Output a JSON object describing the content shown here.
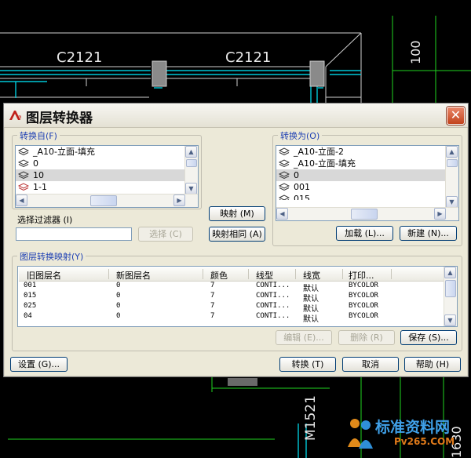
{
  "cad": {
    "labels": [
      "C2121",
      "C2121",
      "100",
      "M1521",
      "1630"
    ]
  },
  "dialog": {
    "title": "图层转换器",
    "close_glyph": "✕",
    "convert_from": {
      "label": "转换自(F)",
      "layers": [
        "_A10-立面-填充",
        "0",
        "10",
        "1-1"
      ],
      "selected_index": 2
    },
    "filter": {
      "label": "选择过滤器 (I)",
      "value": "",
      "select_button": "选择 (C)"
    },
    "map_button": "映射 (M)",
    "map_same_button": "映射相同 (A)",
    "convert_to": {
      "label": "转换为(O)",
      "layers": [
        "_A10-立面-2",
        "_A10-立面-填充",
        "0",
        "001",
        "015"
      ],
      "selected_index": 2,
      "load_button": "加载 (L)...",
      "new_button": "新建 (N)..."
    },
    "mapping": {
      "label": "图层转换映射(Y)",
      "columns": [
        "旧图层名",
        "新图层名",
        "颜色",
        "线型",
        "线宽",
        "打印..."
      ],
      "rows": [
        {
          "old": "001",
          "new": "0",
          "color": "7",
          "linetype": "CONTI...",
          "lineweight": "默认",
          "plot": "BYCOLOR"
        },
        {
          "old": "015",
          "new": "0",
          "color": "7",
          "linetype": "CONTI...",
          "lineweight": "默认",
          "plot": "BYCOLOR"
        },
        {
          "old": "025",
          "new": "0",
          "color": "7",
          "linetype": "CONTI...",
          "lineweight": "默认",
          "plot": "BYCOLOR"
        },
        {
          "old": "04",
          "new": "0",
          "color": "7",
          "linetype": "CONTI...",
          "lineweight": "默认",
          "plot": "BYCOLOR"
        }
      ],
      "edit_button": "编辑 (E)...",
      "delete_button": "删除 (R)",
      "save_button": "保存 (S)..."
    },
    "settings_button": "设置 (G)...",
    "convert_button": "转换 (T)",
    "cancel_button": "取消",
    "help_button": "帮助 (H)"
  },
  "watermark": {
    "text": "标准资料网",
    "subtext": "Pv265.COM"
  }
}
